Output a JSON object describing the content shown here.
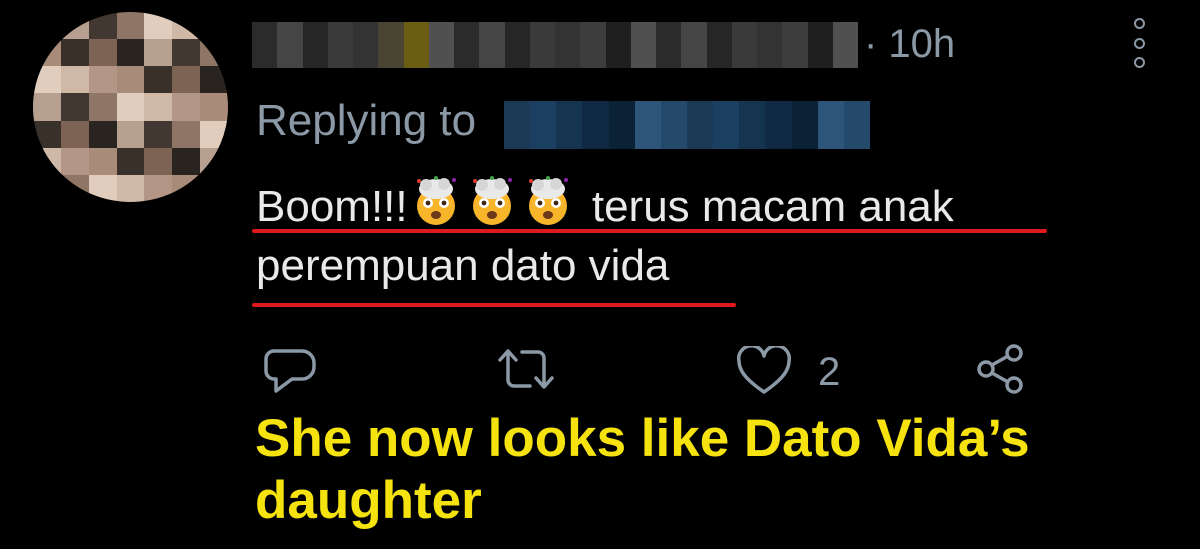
{
  "tweet": {
    "timestamp": "· 10h",
    "reply_prefix": "Replying to",
    "text_start": "Boom!!!",
    "text_after_emoji": " terus macam anak",
    "text_line2": "perempuan dato vida",
    "emoji_name": "exploding-head-emoji",
    "emoji_count": 3
  },
  "actions": {
    "reply_icon": "reply-icon",
    "retweet_icon": "retweet-icon",
    "like_icon": "heart-icon",
    "like_count": "2",
    "share_icon": "share-icon"
  },
  "caption": {
    "text": "She now looks like Dato Vida’s daughter"
  },
  "colors": {
    "background": "#000000",
    "secondary_text": "#8b98a5",
    "primary_text": "#e7e9ea",
    "underline": "#e01a1a",
    "caption": "#f5e20f"
  }
}
